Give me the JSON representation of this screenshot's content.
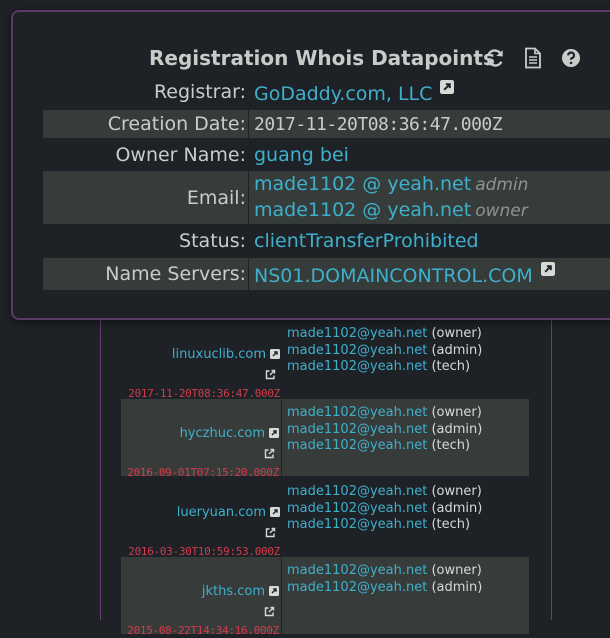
{
  "whois": {
    "title": "Registration Whois Datapoints",
    "registrar_label": "Registrar:",
    "registrar_value": "GoDaddy.com, LLC",
    "creation_label": "Creation Date:",
    "creation_value": "2017-11-20T08:36:47.000Z",
    "owner_label": "Owner Name:",
    "owner_value": "guang bei",
    "email_label": "Email:",
    "emails": [
      {
        "address": "made1102 @ yeah.net",
        "role": "admin"
      },
      {
        "address": "made1102 @ yeah.net",
        "role": "owner"
      }
    ],
    "status_label": "Status:",
    "status_value": "clientTransferProhibited",
    "ns_label": "Name Servers:",
    "ns_value": "NS01.DOMAINCONTROL.COM",
    "icons": [
      "refresh-icon",
      "document-icon",
      "help-icon",
      "external-link-icon"
    ]
  },
  "domains": [
    {
      "name": "linuxuclib.com",
      "date": "2017-11-20T08:36:47.000Z",
      "contacts": [
        {
          "email": "made1102@yeah.net",
          "role": "(owner)"
        },
        {
          "email": "made1102@yeah.net",
          "role": "(admin)"
        },
        {
          "email": "made1102@yeah.net",
          "role": "(tech)"
        }
      ]
    },
    {
      "name": "hyczhuc.com",
      "date": "2016-09-01T07:15:20.000Z",
      "contacts": [
        {
          "email": "made1102@yeah.net",
          "role": "(owner)"
        },
        {
          "email": "made1102@yeah.net",
          "role": "(admin)"
        },
        {
          "email": "made1102@yeah.net",
          "role": "(tech)"
        }
      ]
    },
    {
      "name": "lueryuan.com",
      "date": "2016-03-30T10:59:53.000Z",
      "contacts": [
        {
          "email": "made1102@yeah.net",
          "role": "(owner)"
        },
        {
          "email": "made1102@yeah.net",
          "role": "(admin)"
        },
        {
          "email": "made1102@yeah.net",
          "role": "(tech)"
        }
      ]
    },
    {
      "name": "jkths.com",
      "date": "2015-08-22T14:34:16.000Z",
      "contacts": [
        {
          "email": "made1102@yeah.net",
          "role": "(owner)"
        },
        {
          "email": "made1102@yeah.net",
          "role": "(admin)"
        }
      ]
    }
  ],
  "colors": {
    "link": "#3fb0cc",
    "date": "#d23c4c",
    "panel_border": "#5b3a6a",
    "row_alt": "#363c3a"
  }
}
